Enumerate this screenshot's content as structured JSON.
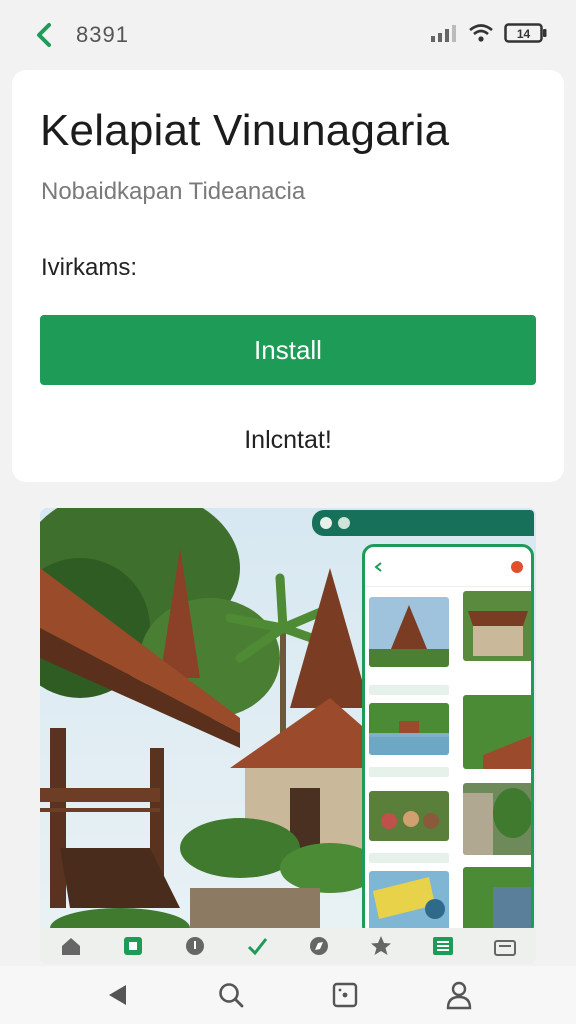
{
  "status_bar": {
    "time": "8391",
    "icons": [
      "back-arrow-icon",
      "signal-icon",
      "wifi-icon",
      "battery-icon"
    ],
    "battery_label": "14"
  },
  "app": {
    "title": "Kelapiat Vinunagaria",
    "subtitle": "Nobaidkapan Tideanacia",
    "meta": "Ivirkams:",
    "install_label": "Install",
    "secondary_label": "Inlcntat!"
  },
  "screenshot": {
    "description_icons": [
      "home-icon",
      "grid-icon",
      "info-icon",
      "check-icon",
      "compass-icon",
      "star-icon",
      "list-icon",
      "gift-icon"
    ]
  },
  "system_nav": {
    "icons": [
      "back-triangle-icon",
      "search-icon",
      "dice-icon",
      "profile-icon"
    ]
  },
  "colors": {
    "accent": "#1f9b58",
    "accent_dark": "#17715a",
    "background": "#f1f2f1",
    "card": "#ffffff"
  }
}
